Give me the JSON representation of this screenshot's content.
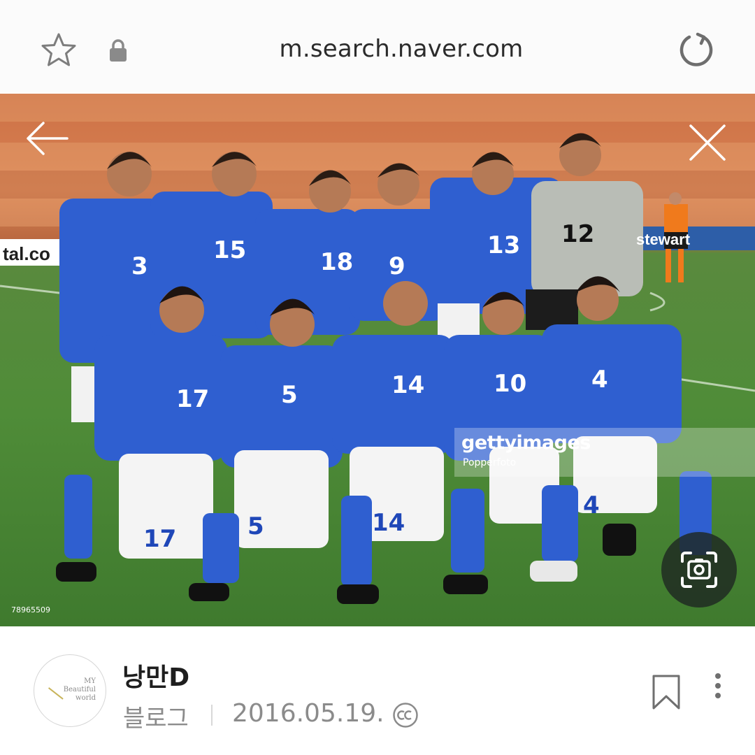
{
  "browser": {
    "url": "m.search.naver.com",
    "icons": {
      "favorite": "star-icon",
      "security": "lock-icon",
      "reload": "reload-icon"
    }
  },
  "viewer": {
    "icons": {
      "back": "back-arrow-icon",
      "close": "close-icon",
      "lens": "camera-lens-icon"
    },
    "watermark": {
      "brand": "gettyimages",
      "credit": "Popperfoto"
    },
    "image_id": "78965509",
    "jersey_numbers": [
      "3",
      "15",
      "18",
      "9",
      "13",
      "12",
      "17",
      "5",
      "14",
      "10",
      "4",
      "17",
      "5",
      "14",
      "4"
    ],
    "ad_board": [
      "tal.co",
      "stewart"
    ]
  },
  "post": {
    "blog_name": "낭만D",
    "avatar_text": [
      "MY",
      "Beautiful",
      "world"
    ],
    "type": "블로그",
    "date": "2016.05.19.",
    "license_icon": "creative-commons-icon",
    "actions": {
      "bookmark": "bookmark-icon",
      "more": "more-vertical-icon"
    }
  },
  "colors": {
    "jersey": "#2f5fd0",
    "pitch": "#4f8c38",
    "crowd": "#d07a48",
    "keeper": "#b9bdb6"
  }
}
